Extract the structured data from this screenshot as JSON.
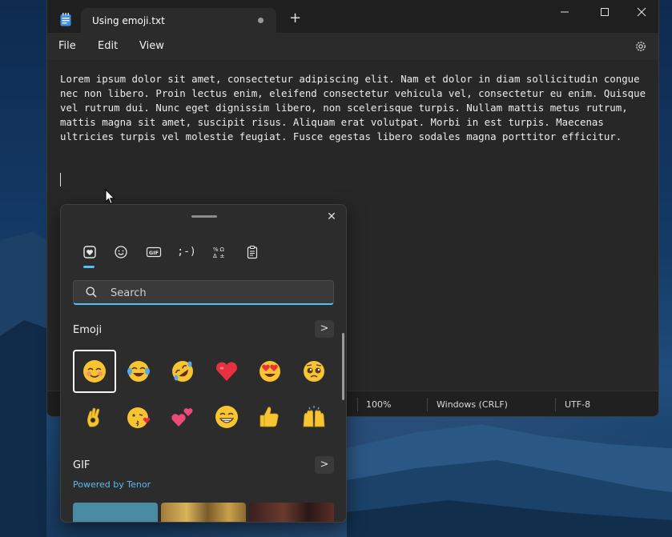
{
  "notepad": {
    "tab_title": "Using emoji.txt",
    "new_tab_symbol": "+",
    "menu": [
      "File",
      "Edit",
      "View"
    ],
    "content": "Lorem ipsum dolor sit amet, consectetur adipiscing elit. Nam et dolor in diam sollicitudin congue nec non libero. Proin lectus enim, eleifend consectetur vehicula vel, consectetur eu enim. Quisque vel rutrum dui. Nunc eget dignissim libero, non scelerisque turpis. Nullam mattis metus rutrum, mattis magna sit amet, suscipit risus. Aliquam erat volutpat. Morbi in est turpis. Maecenas ultricies turpis vel molestie feugiat. Fusce egestas libero sodales magna porttitor efficitur.",
    "status": {
      "zoom": "100%",
      "line_ending": "Windows (CRLF)",
      "encoding": "UTF-8"
    }
  },
  "emoji_panel": {
    "close_symbol": "✕",
    "tabs": [
      {
        "name": "favorites-icon",
        "glyph": "♥"
      },
      {
        "name": "emoji-icon",
        "glyph": "☺"
      },
      {
        "name": "gif-icon",
        "glyph": "GIF"
      },
      {
        "name": "kaomoji-icon",
        "glyph": ";-)"
      },
      {
        "name": "symbols-icon",
        "glyph": "%Ω"
      },
      {
        "name": "clipboard-icon",
        "glyph": "📋"
      }
    ],
    "search_placeholder": "Search",
    "emoji_section_title": "Emoji",
    "gif_section_title": "GIF",
    "more_symbol": ">",
    "powered_by": "Powered by Tenor",
    "emojis": [
      "smiling-face-with-smiling-eyes",
      "face-with-tears-of-joy",
      "rolling-on-the-floor-laughing",
      "red-heart",
      "smiling-face-with-heart-eyes",
      "pleading-face",
      "ok-hand",
      "face-blowing-a-kiss",
      "two-hearts",
      "beaming-face-with-smiling-eyes",
      "thumbs-up",
      "raising-hands"
    ]
  },
  "colors": {
    "accent": "#4cc2ff",
    "window_bg": "#272727",
    "panel_bg": "#2c2c2c"
  }
}
